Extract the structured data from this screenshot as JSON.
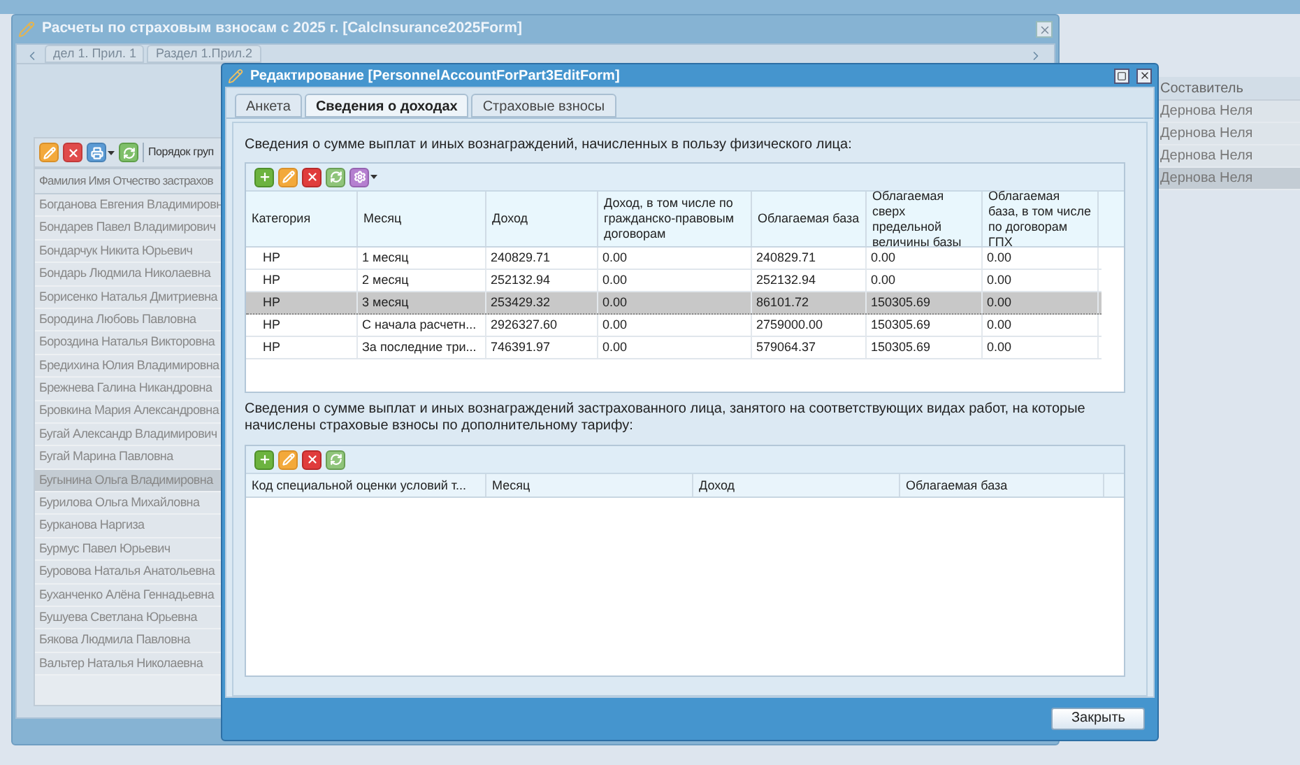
{
  "background_grid": {
    "column": "Составитель",
    "rows": [
      {
        "cell": "Дернова Неля",
        "selected": false
      },
      {
        "cell": "Дернова Неля",
        "selected": false
      },
      {
        "cell": "Дернова Неля",
        "selected": false
      },
      {
        "cell": "Дернова Неля",
        "selected": true
      }
    ]
  },
  "main_window": {
    "title": "Расчеты по страховым взносам с 2025 г. [CalcInsurance2025Form]",
    "tabs": [
      {
        "label": "дел 1. Прил. 1",
        "selected": false
      },
      {
        "label": "Раздел 1.Прил.2",
        "selected": false
      }
    ],
    "group_label": "Порядок груп",
    "grid": {
      "column": "Фамилия Имя Отчество застрахов",
      "rows": [
        {
          "name": "Богданова Евгения Владимировн",
          "selected": false
        },
        {
          "name": "Бондарев Павел Владимирович",
          "selected": false
        },
        {
          "name": "Бондарчук Никита Юрьевич",
          "selected": false
        },
        {
          "name": "Бондарь Людмила Николаевна",
          "selected": false
        },
        {
          "name": "Борисенко Наталья Дмитриевна",
          "selected": false
        },
        {
          "name": "Бородина Любовь Павловна",
          "selected": false
        },
        {
          "name": "Бороздина Наталья Викторовна",
          "selected": false
        },
        {
          "name": "Бредихина Юлия Владимировна",
          "selected": false
        },
        {
          "name": "Брежнева Галина Никандровна",
          "selected": false
        },
        {
          "name": "Бровкина Мария Александровна",
          "selected": false
        },
        {
          "name": "Бугай Александр Владимирович",
          "selected": false
        },
        {
          "name": "Бугай Марина Павловна",
          "selected": false
        },
        {
          "name": "Бугынина Ольга Владимировна",
          "selected": true
        },
        {
          "name": "Бурилова Ольга Михайловна",
          "selected": false
        },
        {
          "name": "Бурканова Наргиза",
          "selected": false
        },
        {
          "name": "Бурмус Павел Юрьевич",
          "selected": false
        },
        {
          "name": "Буровова Наталья Анатольевна",
          "selected": false
        },
        {
          "name": "Буханченко Алёна Геннадьевна",
          "selected": false
        },
        {
          "name": "Бушуева Светлана Юрьевна",
          "selected": false
        },
        {
          "name": "Бякова Людмила Павловна",
          "selected": false
        },
        {
          "name": "Вальтер Наталья Николаевна",
          "selected": false
        }
      ]
    }
  },
  "dialog": {
    "title": "Редактирование [PersonnelAccountForPart3EditForm]",
    "tabs": [
      {
        "label": "Анкета",
        "selected": false
      },
      {
        "label": "Сведения о доходах",
        "selected": true
      },
      {
        "label": "Страховые взносы",
        "selected": false
      }
    ],
    "income": {
      "label": "Сведения о сумме выплат и иных вознаграждений, начисленных в пользу физического лица:",
      "columns": [
        "Категория",
        "Месяц",
        "Доход",
        "Доход, в том числе по гражданско-правовым договорам",
        "Облагаемая база",
        "Облагаемая сверх предельной величины базы",
        "Облагаемая база, в том числе по договорам ГПХ"
      ],
      "rows": [
        {
          "cells": [
            "НР",
            "1 месяц",
            "240829.71",
            "0.00",
            "240829.71",
            "0.00",
            "0.00"
          ],
          "selected": false
        },
        {
          "cells": [
            "НР",
            "2 месяц",
            "252132.94",
            "0.00",
            "252132.94",
            "0.00",
            "0.00"
          ],
          "selected": false
        },
        {
          "cells": [
            "НР",
            "3 месяц",
            "253429.32",
            "0.00",
            "86101.72",
            "150305.69",
            "0.00"
          ],
          "selected": true
        },
        {
          "cells": [
            "НР",
            "С начала расчетн...",
            "2926327.60",
            "0.00",
            "2759000.00",
            "150305.69",
            "0.00"
          ],
          "selected": false
        },
        {
          "cells": [
            "НР",
            "За последние три...",
            "746391.97",
            "0.00",
            "579064.37",
            "150305.69",
            "0.00"
          ],
          "selected": false
        }
      ]
    },
    "additional": {
      "label": "Сведения о сумме выплат и иных вознаграждений застрахованного лица, занятого на соответствующих видах работ, на которые начислены страховые взносы по дополнительному тарифу:",
      "columns": [
        "Код специальной оценки условий т...",
        "Месяц",
        "Доход",
        "Облагаемая база"
      ]
    },
    "buttons": [
      "Закрыть"
    ]
  }
}
